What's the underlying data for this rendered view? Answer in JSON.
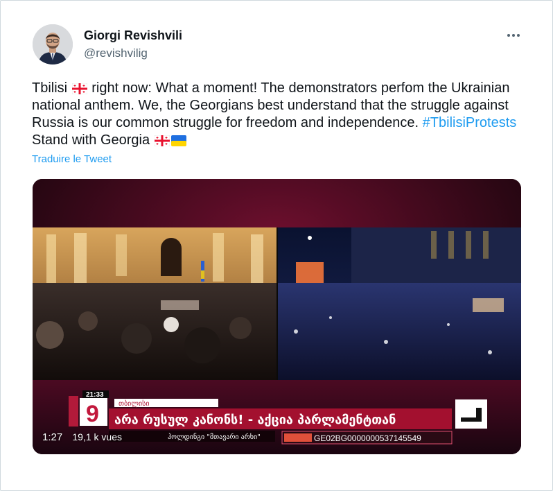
{
  "tweet": {
    "author": {
      "name": "Giorgi Revishvili",
      "handle": "@revishvilig"
    },
    "text": {
      "part1": "Tbilisi",
      "part2": "right now: What a moment! The demonstrators perfom the Ukrainian national anthem. We, the Georgians best understand that the struggle against Russia is our common struggle for freedom and independence.",
      "hashtag": "#TbilisiProtests",
      "part3": "Stand with Georgia"
    },
    "translate_label": "Traduire le Tweet",
    "more_icon": "ellipsis-icon"
  },
  "video": {
    "duration": "1:27",
    "views": "19,1 k vues",
    "overlay": {
      "clock": "21:33",
      "channel_number": "9",
      "location": "თბილისი",
      "headline": "არა რუსულ კანონს! - აქცია პარლამენტთან",
      "ticker": "ჰოლდინგი \"მთავარი არხი\"",
      "iban": "GE02BG0000000537145549"
    }
  },
  "colors": {
    "link": "#1d9bf0",
    "text": "#0f1419",
    "secondary": "#536471",
    "border": "#cfd9de"
  }
}
